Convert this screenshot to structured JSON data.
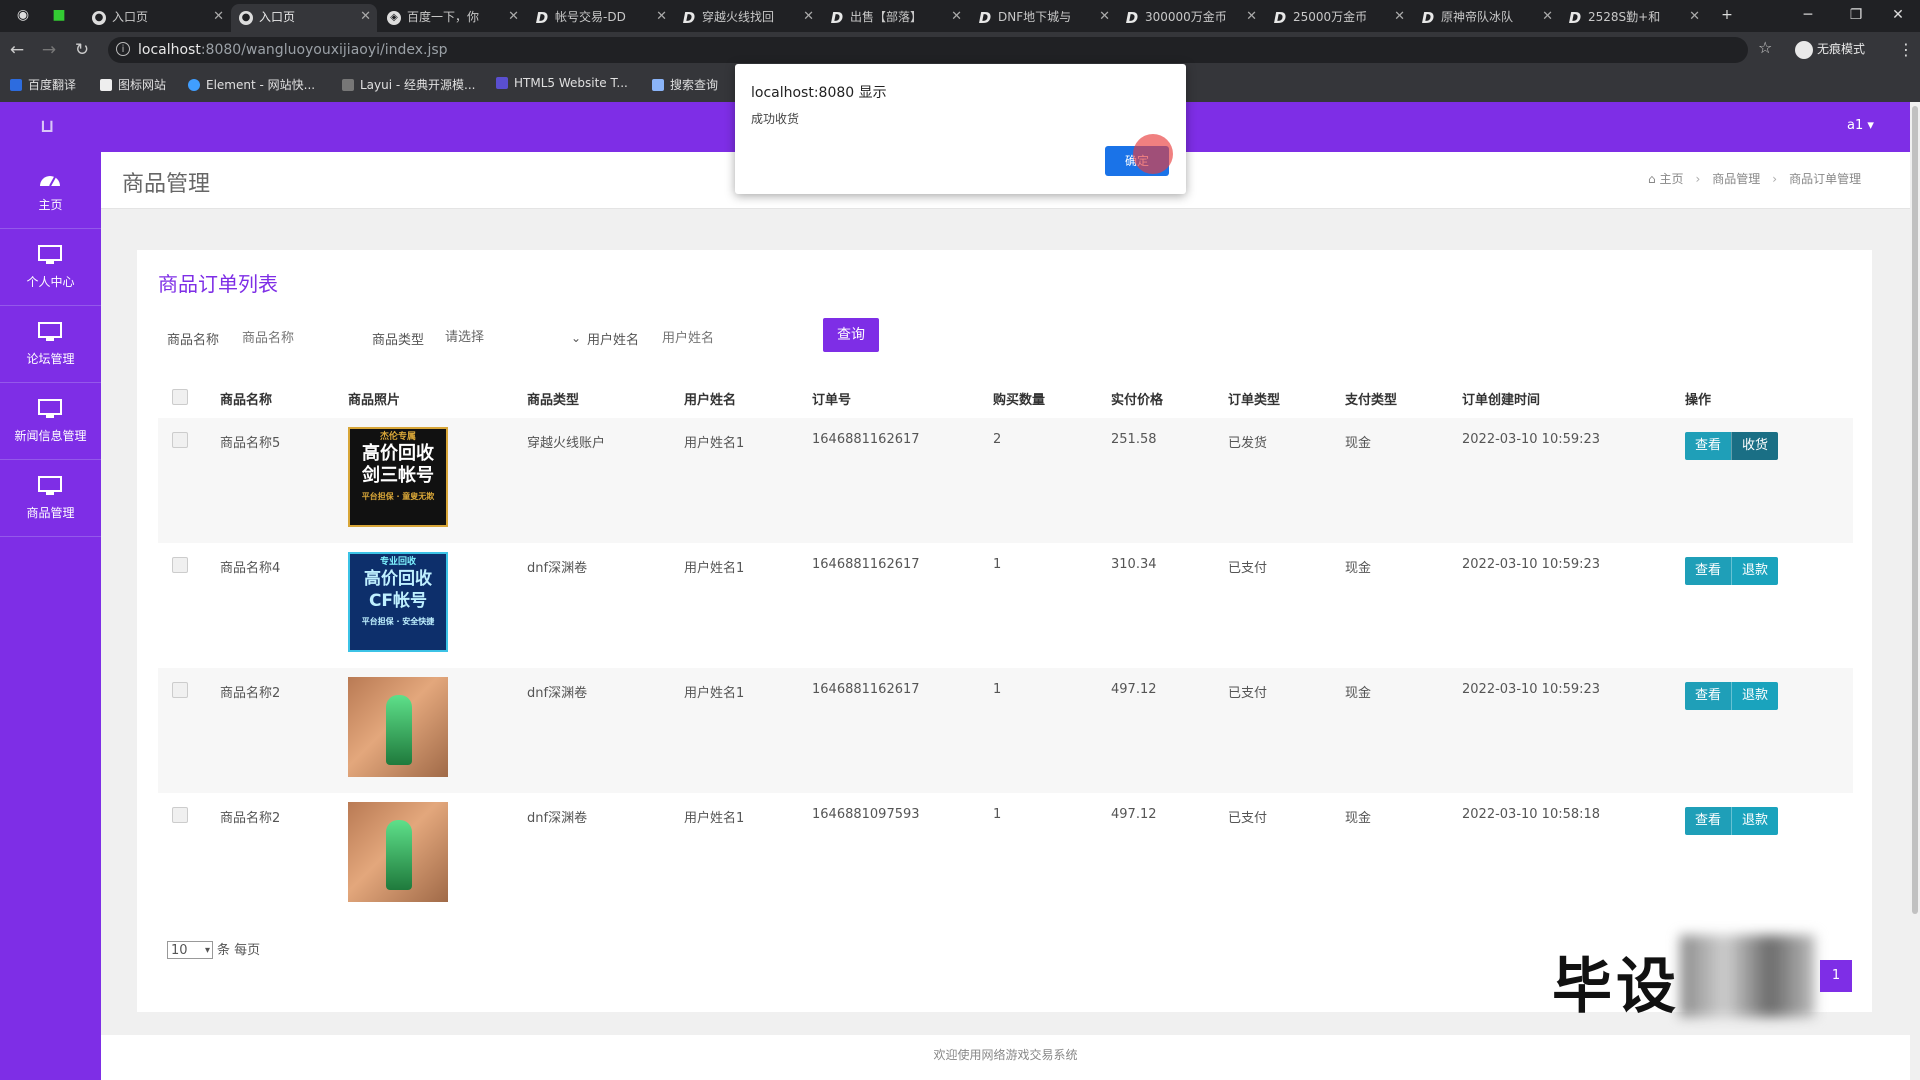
{
  "browser": {
    "tabs": [
      {
        "title": "入口页",
        "icon": "chrome-icon"
      },
      {
        "title": "入口页",
        "icon": "chrome-icon"
      },
      {
        "title": "百度一下，你",
        "icon": "baidu-icon"
      },
      {
        "title": "帐号交易-DD",
        "icon": "d-icon"
      },
      {
        "title": "穿越火线找回",
        "icon": "d-icon"
      },
      {
        "title": "出售【部落】",
        "icon": "d-icon"
      },
      {
        "title": "DNF地下城与",
        "icon": "d-icon"
      },
      {
        "title": "300000万金币",
        "icon": "d-icon"
      },
      {
        "title": "25000万金币",
        "icon": "d-icon"
      },
      {
        "title": "原神帝队冰队",
        "icon": "d-icon"
      },
      {
        "title": "2528S勤+和",
        "icon": "d-icon"
      }
    ],
    "new_tab": "+",
    "url_host": "localhost",
    "url_path": ":8080/wangluoyouxijiaoyi/index.jsp",
    "incognito_label": "无痕模式",
    "bookmarks": [
      "百度翻译",
      "图标网站",
      "Element - 网站快...",
      "Layui - 经典开源模...",
      "HTML5 Website T...",
      "搜索查询"
    ]
  },
  "dialog": {
    "title": "localhost:8080 显示",
    "message": "成功收货",
    "ok_label": "确定"
  },
  "topbar": {
    "logo": "",
    "user": "a1"
  },
  "sidebar": {
    "items": [
      {
        "label": "主页",
        "icon": "dashboard-icon"
      },
      {
        "label": "个人中心",
        "icon": "monitor-icon"
      },
      {
        "label": "论坛管理",
        "icon": "monitor-icon"
      },
      {
        "label": "新闻信息管理",
        "icon": "monitor-icon"
      },
      {
        "label": "商品管理",
        "icon": "monitor-icon"
      }
    ]
  },
  "header": {
    "title": "商品管理",
    "breadcrumb": [
      "主页",
      "商品管理",
      "商品订单管理"
    ]
  },
  "card": {
    "title": "商品订单列表",
    "filters": {
      "name_label": "商品名称",
      "name_placeholder": "商品名称",
      "type_label": "商品类型",
      "type_selected": "请选择",
      "user_label": "用户姓名",
      "user_placeholder": "用户姓名",
      "query_label": "查询"
    },
    "columns": [
      "商品名称",
      "商品照片",
      "商品类型",
      "用户姓名",
      "订单号",
      "购买数量",
      "实付价格",
      "订单类型",
      "支付类型",
      "订单创建时间",
      "操作"
    ],
    "rows": [
      {
        "name": "商品名称5",
        "image": {
          "kind": "t1",
          "tag": "杰伦专属",
          "line1": "高价回收",
          "line2": "剑三帐号",
          "sub": "平台担保 · 童叟无欺"
        },
        "type": "穿越火线账户",
        "user": "用户姓名1",
        "order_no": "1646881162617",
        "qty": "2",
        "price": "251.58",
        "order_type": "已发货",
        "pay_type": "现金",
        "created": "2022-03-10 10:59:23",
        "view": "查看",
        "action": "收货",
        "action_style": "dark"
      },
      {
        "name": "商品名称4",
        "image": {
          "kind": "t2",
          "tag": "专业回收",
          "line1": "高价回收",
          "line2": "CF帐号",
          "sub": "平台担保 · 安全快捷"
        },
        "type": "dnf深渊卷",
        "user": "用户姓名1",
        "order_no": "1646881162617",
        "qty": "1",
        "price": "310.34",
        "order_type": "已支付",
        "pay_type": "现金",
        "created": "2022-03-10 10:59:23",
        "view": "查看",
        "action": "退款",
        "action_style": "light"
      },
      {
        "name": "商品名称2",
        "image": {
          "kind": "t3"
        },
        "type": "dnf深渊卷",
        "user": "用户姓名1",
        "order_no": "1646881162617",
        "qty": "1",
        "price": "497.12",
        "order_type": "已支付",
        "pay_type": "现金",
        "created": "2022-03-10 10:59:23",
        "view": "查看",
        "action": "退款",
        "action_style": "light"
      },
      {
        "name": "商品名称2",
        "image": {
          "kind": "t3"
        },
        "type": "dnf深渊卷",
        "user": "用户姓名1",
        "order_no": "1646881097593",
        "qty": "1",
        "price": "497.12",
        "order_type": "已支付",
        "pay_type": "现金",
        "created": "2022-03-10 10:58:18",
        "view": "查看",
        "action": "退款",
        "action_style": "light"
      }
    ],
    "page_size": "10",
    "page_size_suffix": "条 每页",
    "current_page": "1"
  },
  "watermark": "毕设",
  "footer": "欢迎使用网络游戏交易系统",
  "colors": {
    "brand": "#7e2ee6",
    "button": "#1f9fb8",
    "dialog_ok": "#1a73e8"
  }
}
